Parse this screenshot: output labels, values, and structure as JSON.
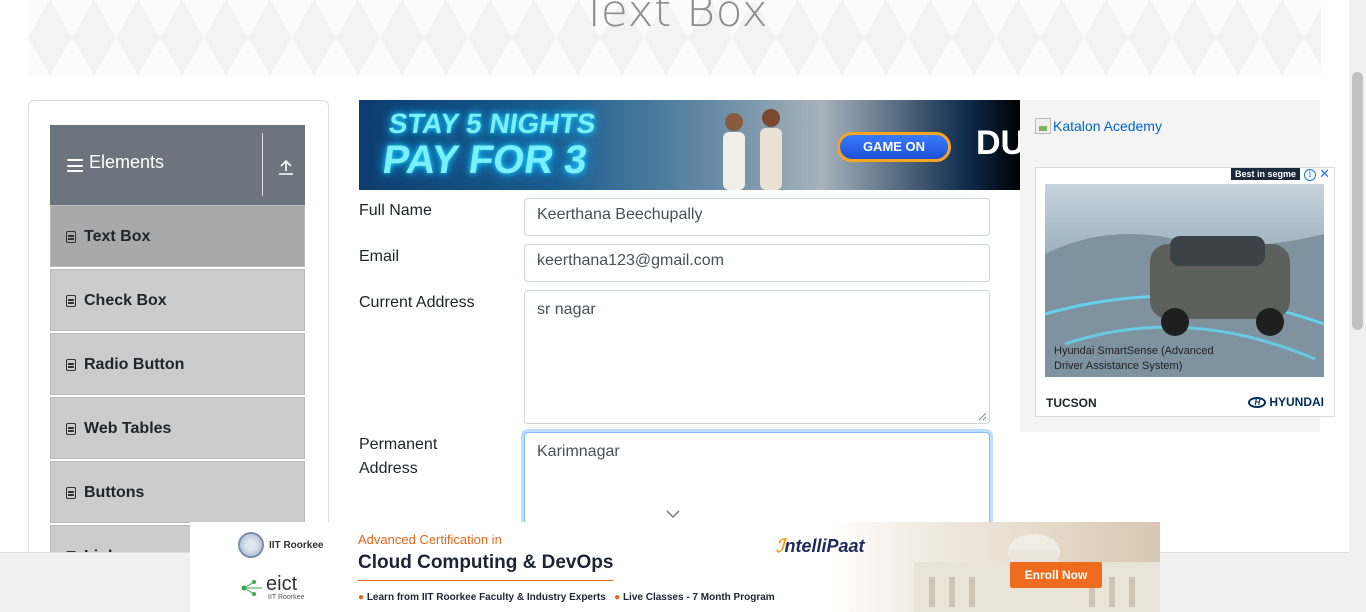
{
  "header": {
    "title": "Text Box"
  },
  "sidebar": {
    "group_title": "Elements",
    "items": [
      {
        "label": "Text Box"
      },
      {
        "label": "Check Box"
      },
      {
        "label": "Radio Button"
      },
      {
        "label": "Web Tables"
      },
      {
        "label": "Buttons"
      },
      {
        "label": "Links"
      }
    ],
    "active_item": "Text Box"
  },
  "form": {
    "full_name": {
      "label": "Full Name",
      "value": "Keerthana Beechupally"
    },
    "email": {
      "label": "Email",
      "value": "keerthana123@gmail.com"
    },
    "current_address": {
      "label": "Current Address",
      "value": "sr nagar"
    },
    "permanent_address": {
      "label_line1": "Permanent",
      "label_line2": "Address",
      "value": "Karimnagar"
    }
  },
  "ad_top": {
    "line1": "STAY 5 NIGHTS",
    "line2": "PAY FOR 3",
    "button": "GAME ON",
    "brand": "DU"
  },
  "ad_right": {
    "link_text": "Katalon Acedemy",
    "badge": "Best in segme",
    "caption": "Hyundai SmartSense (Advanced Driver Assistance System)",
    "model": "TUCSON",
    "brand": "HYUNDAI"
  },
  "ad_bottom": {
    "org1": "IIT Roorkee",
    "org2": "eict",
    "org2_sub": "IIT Roorkee",
    "headline_small": "Advanced Certification in",
    "headline": "Cloud Computing & DevOps",
    "bullet1": "Learn from IIT Roorkee Faculty & Industry Experts",
    "bullet2": "Live Classes - 7 Month Program",
    "brand": "ntelliPaat",
    "cta": "Enroll Now"
  },
  "colors": {
    "sidebar_header": "#6c757d",
    "menu_item": "#cccccc",
    "menu_item_active": "#a9a9a9",
    "focus_border": "#80bdff",
    "link": "#0066cc",
    "cta": "#ef6c1f"
  }
}
